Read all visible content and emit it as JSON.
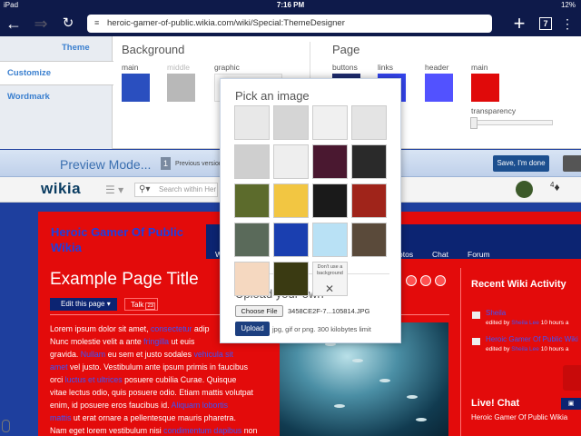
{
  "status": {
    "device": "iPad",
    "time": "7:16 PM",
    "battery": "12%"
  },
  "browser": {
    "url": "heroic-gamer-of-public.wikia.com/wiki/Special:ThemeDesigner",
    "tab_count": "7"
  },
  "designer": {
    "tabs": [
      {
        "label": "Theme"
      },
      {
        "label": "Customize"
      },
      {
        "label": "Wordmark"
      }
    ],
    "background": {
      "title": "Background",
      "main_label": "main",
      "middle_label": "middle",
      "graphic_label": "graphic",
      "main_color": "#2a4fbf",
      "middle_color": "#b8b8b8"
    },
    "page": {
      "title": "Page",
      "buttons_label": "buttons",
      "links_label": "links",
      "header_label": "header",
      "main_label": "main",
      "transparency_label": "transparency",
      "buttons_color": "#1c2a6e",
      "links_color": "#3344ee",
      "header_color": "#5252ff",
      "main_color": "#e00a0a"
    }
  },
  "preview": {
    "title": "Preview Mode...",
    "version_num": "1",
    "version_label": "Previous version",
    "save_label": "Save, I'm done"
  },
  "wikia": {
    "logo": "wikia",
    "search_placeholder": "Search within Her",
    "notif_count": "4"
  },
  "wiki": {
    "name": "Heroic Gamer Of Public Wikia",
    "nav_items": [
      "W",
      "otos",
      "Chat",
      "Forum"
    ],
    "page_title": "Example Page Title",
    "edit_label": "Edit this page",
    "talk_label": "Talk",
    "talk_count": "23",
    "body_lines": [
      {
        "text": "Lorem ipsum dolor sit amet, ",
        "link": "consectetur",
        "rest": " adip"
      },
      {
        "text": "Nunc molestie velit a ante ",
        "link": "fringilla",
        "rest": " ut euis"
      },
      {
        "text": "gravida. ",
        "link": "Nullam",
        "rest": " eu sem et justo sodales ",
        "link2": "vehicula sit"
      },
      {
        "text": "",
        "link": "amet",
        "rest": " vel justo. Vestibulum ante ipsum primis in faucibus"
      },
      {
        "text": "orci ",
        "link": "luctus et ultrices",
        "rest": " posuere cubilia Curae. Quisque"
      },
      {
        "text": "vitae lectus odio, quis posuere odio. Etiam mattis volutpat"
      },
      {
        "text": "enim, id posuere eros faucibus id. ",
        "link": "Aliquam lobortis"
      },
      {
        "text": "",
        "link": "mattis",
        "rest": " ut erat ornare a pellentesque mauris pharetra."
      },
      {
        "text": "Nam eget lorem vestibulum nisi ",
        "link": "condimentum dapibus",
        "rest": " non"
      }
    ]
  },
  "rail": {
    "activity_title": "Recent Wiki Activity",
    "items": [
      {
        "title": "Sheila",
        "meta_prefix": "edited by ",
        "editor": "Sheila Lee",
        "time": " 10 hours a"
      },
      {
        "title": "Heroic Gamer Of Public Wiki",
        "meta_prefix": "edited by ",
        "editor": "Sheila Lee",
        "time": " 10 hours a"
      }
    ],
    "chat_title": "Live! Chat",
    "chat_sub": "Heroic Gamer Of Public Wikia"
  },
  "modal": {
    "title": "Pick an image",
    "thumbs": [
      {
        "name": "thumb-white-circles",
        "bg": "#e8e8e8"
      },
      {
        "name": "thumb-gray-damask",
        "bg": "#d5d5d5"
      },
      {
        "name": "thumb-dots",
        "bg": "#f0f0f0"
      },
      {
        "name": "thumb-light-dots",
        "bg": "#e4e4e4"
      },
      {
        "name": "thumb-ornament",
        "bg": "#cfcfcf"
      },
      {
        "name": "thumb-white-texture",
        "bg": "#eeeeee"
      },
      {
        "name": "thumb-purple-streaks",
        "bg": "#4a1830"
      },
      {
        "name": "thumb-dark-gray",
        "bg": "#2a2a2a"
      },
      {
        "name": "thumb-olive",
        "bg": "#5c6b2c"
      },
      {
        "name": "thumb-yellow-bokeh",
        "bg": "#f2c642"
      },
      {
        "name": "thumb-carbon",
        "bg": "#1a1a1a"
      },
      {
        "name": "thumb-fire",
        "bg": "#a0241a"
      },
      {
        "name": "thumb-rust",
        "bg": "#5a6a5a"
      },
      {
        "name": "thumb-blue-swirl",
        "bg": "#1a3fb0"
      },
      {
        "name": "thumb-bird",
        "bg": "#b9e1f5"
      },
      {
        "name": "thumb-moon",
        "bg": "#5a4a3a"
      },
      {
        "name": "thumb-stripes",
        "bg": "#f5d8c0"
      },
      {
        "name": "thumb-green-grid",
        "bg": "#3a3a12"
      }
    ],
    "no_background_label": "Don't use a background",
    "upload_title": "Upload your own",
    "choose_label": "Choose File",
    "filename": "3458CE2F-7...105814.JPG",
    "upload_label": "Upload",
    "upload_hint": "jpg, gif or png. 300 kilobytes limit"
  }
}
